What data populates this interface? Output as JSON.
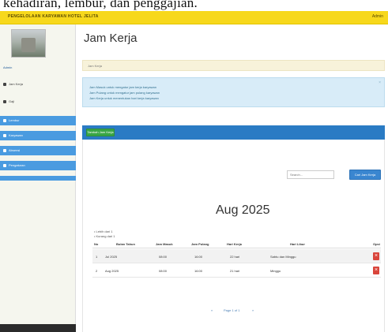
{
  "caption": "kehadiran, lembur, dan penggajian.",
  "topbar": {
    "brand": "PENGELOLAAN KARYAWAN HOTEL JELITA",
    "user": "Admin"
  },
  "sidebar": {
    "profile": "Admin",
    "items": [
      {
        "label": "Jam Kerja"
      },
      {
        "label": "Gaji"
      },
      {
        "label": "Lembur"
      },
      {
        "label": "Karyawan"
      },
      {
        "label": "Absensi"
      },
      {
        "label": "Pengaturan"
      }
    ]
  },
  "main": {
    "title": "Jam Kerja",
    "breadcrumb": "Jam Kerja",
    "alerts": [
      "Jam Masuk untuk mengatur jam kerja karyawan",
      "Jam Pulang untuk mengatur jam pulang karyawan",
      "Jam Kerja untuk menentukan hari kerja karyawan"
    ],
    "add_button": "Tambah Jam Kerja",
    "search_placeholder": "Search...",
    "search_button": "Cari Jam Kerja",
    "month": "Aug 2025",
    "legend": [
      "Lebih dari 1",
      "Kurang dari 1"
    ],
    "table": {
      "columns": [
        "No",
        "Bulan Tahun",
        "Jam Masuk",
        "Jam Pulang",
        "Hari Kerja",
        "Hari Libur",
        "Opsi"
      ],
      "rows": [
        {
          "no": "1",
          "bulan": "Jul 2025",
          "masuk": "08:00",
          "pulang": "16:00",
          "hari": "22 hari",
          "libur": "Sabtu dan Minggu"
        },
        {
          "no": "2",
          "bulan": "Aug 2025",
          "masuk": "08:00",
          "pulang": "16:00",
          "hari": "21 hari",
          "libur": "Minggu"
        }
      ]
    },
    "pager": {
      "prev": "«",
      "label": "Page 1 of 1",
      "next": "»"
    }
  }
}
